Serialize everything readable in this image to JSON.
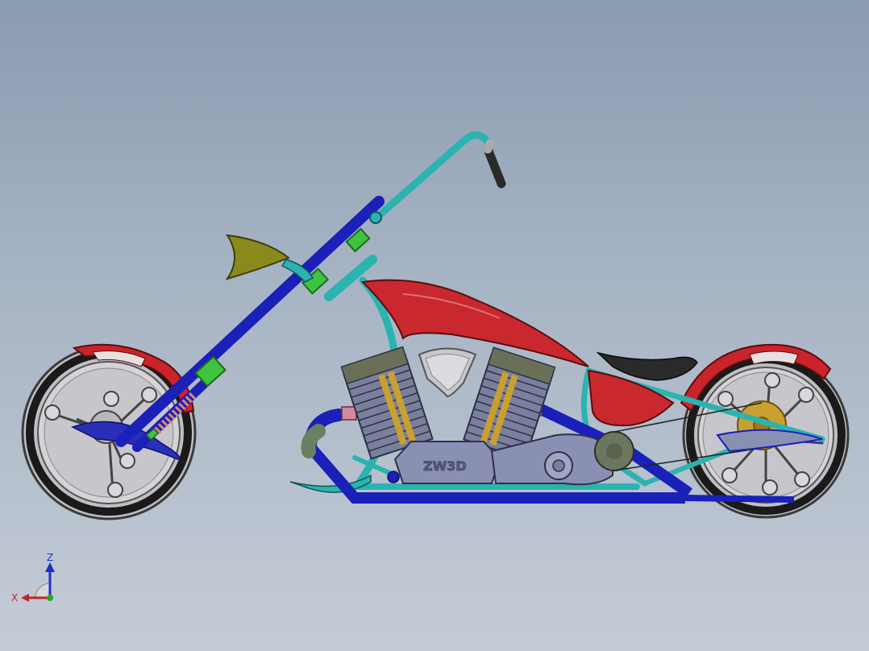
{
  "viewport": {
    "background_top": "#8a9bb0",
    "background_bottom": "#c4ccd6"
  },
  "model": {
    "engine_logo": "ZW3D"
  },
  "triad": {
    "z_label": "Z",
    "x_label": "X",
    "z_color": "#1f2fc9",
    "x_color": "#c0242a",
    "y_color": "#2aa52a"
  },
  "colors": {
    "frame_teal": "#2bb3b0",
    "fork_blue": "#1a20b8",
    "fender_red": "#c8242a",
    "tank_red": "#c8282e",
    "engine_gray": "#7a7f9c",
    "tire_black": "#1a1a1a",
    "rim_silver": "#c9c9cc",
    "clamp_green": "#3ec43e",
    "light_olive": "#8a8a1c",
    "hub_gold": "#c9a030",
    "seat_black": "#2a2a2a"
  }
}
